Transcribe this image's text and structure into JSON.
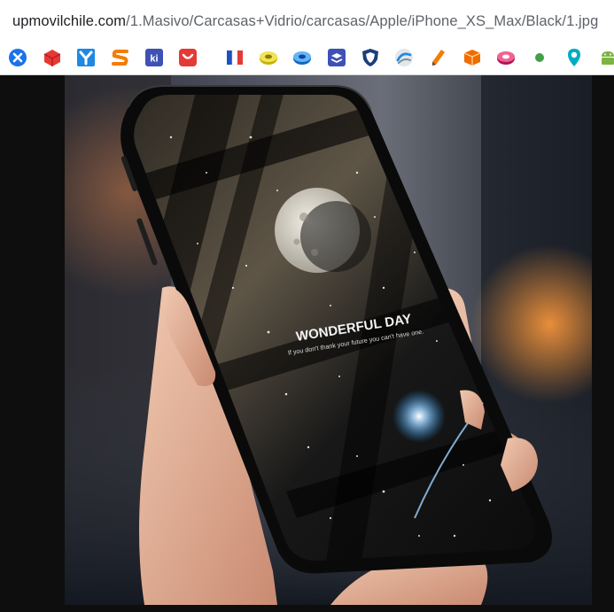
{
  "address_bar": {
    "host": "upmovilchile.com",
    "path": "/1.Masivo/Carcasas+Vidrio/carcasas/Apple/iPhone_XS_Max/Black/1.jpg"
  },
  "bookmarks": [
    {
      "name": "bookmark-close-circle-icon",
      "color": "#1a73e8"
    },
    {
      "name": "bookmark-red-cube-icon",
      "color": "#e53935"
    },
    {
      "name": "bookmark-blue-y-icon",
      "color": "#1e88e5"
    },
    {
      "name": "bookmark-orange-s-icon",
      "color": "#f57c00"
    },
    {
      "name": "bookmark-ki-icon",
      "color": "#3f51b5"
    },
    {
      "name": "bookmark-red-shop-bag-icon",
      "color": "#e53935"
    },
    {
      "name": "bookmark-flag-icon",
      "color": "#1e4fc4"
    },
    {
      "name": "bookmark-yellow-disc-icon",
      "color": "#c6b400"
    },
    {
      "name": "bookmark-blue-disc-icon",
      "color": "#1e88e5"
    },
    {
      "name": "bookmark-blue-layers-icon",
      "color": "#3f51b5"
    },
    {
      "name": "bookmark-shield-icon",
      "color": "#1a3f7a"
    },
    {
      "name": "bookmark-grey-swirl-icon",
      "color": "#78909c"
    },
    {
      "name": "bookmark-pencil-icon",
      "color": "#f57c00"
    },
    {
      "name": "bookmark-orange-box-icon",
      "color": "#ef6c00"
    },
    {
      "name": "bookmark-pink-disc-icon",
      "color": "#d81b60"
    },
    {
      "name": "bookmark-green-dot-icon",
      "color": "#43a047"
    },
    {
      "name": "bookmark-location-pin-icon",
      "color": "#00acc1"
    },
    {
      "name": "bookmark-android-icon",
      "color": "#7cb342"
    }
  ],
  "image": {
    "alt_name": "iphone-xs-max-black-case-photo",
    "screen_heading": "WONDERFUL DAY",
    "screen_subtext": "If you don't thank your future you can't have one."
  }
}
